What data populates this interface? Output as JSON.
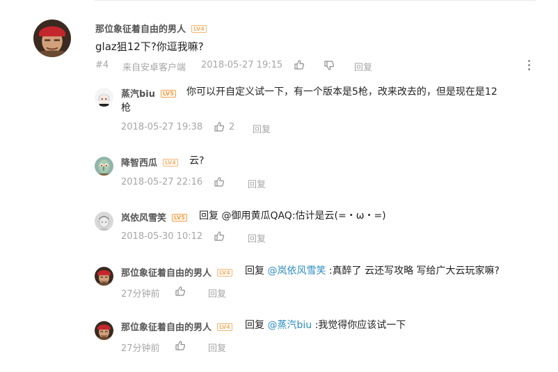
{
  "main_comment": {
    "username": "那位象征着自由的男人",
    "level": "LV4",
    "text": "glaz狙12下?你逗我嘛?",
    "floor": "#4",
    "source": "来自安卓客户端",
    "time": "2018-05-27 19:15",
    "reply_label": "回复"
  },
  "replies": [
    {
      "username": "蒸汽biu",
      "level": "LV5",
      "text_line1": "你可以开自定义试一下，有一个版本是5枪，改来改去的，但是现在是12",
      "text_line2": "枪",
      "time": "2018-05-27 19:38",
      "like_count": "2",
      "reply_label": "回复"
    },
    {
      "username": "降智西瓜",
      "level": "LV4",
      "text": "云?",
      "time": "2018-05-27 22:16",
      "reply_label": "回复"
    },
    {
      "username": "岚依风雪笑",
      "level": "LV5",
      "text": "回复 @御用黄瓜QAQ:估计是云(=・ω・=)",
      "time": "2018-05-30 10:12",
      "reply_label": "回复"
    },
    {
      "username": "那位象征着自由的男人",
      "level": "LV4",
      "prefix": "回复",
      "mention": "@岚依风雪笑",
      "text": ":真醉了 云还写攻略 写给广大云玩家嘛?",
      "time": "27分钟前",
      "reply_label": "回复"
    },
    {
      "username": "那位象征着自由的男人",
      "level": "LV4",
      "prefix": "回复",
      "mention": "@蒸汽biu",
      "text": ":我觉得你应该试一下",
      "time": "27分钟前",
      "reply_label": "回复"
    }
  ],
  "colors": {
    "link": "#2d8cc0",
    "meta": "#a6a6a6",
    "level_badge": "#f39a3a"
  }
}
